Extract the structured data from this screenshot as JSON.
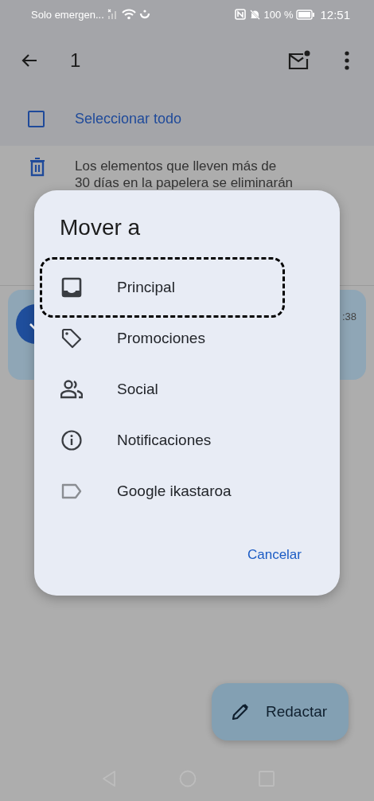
{
  "status_bar": {
    "carrier": "Solo emergen...",
    "battery": "100 %",
    "time": "12:51"
  },
  "toolbar": {
    "count": "1"
  },
  "select_all": {
    "label": "Seleccionar todo",
    "checked": false
  },
  "trash_notice": {
    "lines": [
      "Los elementos que lleven más de",
      "30 días en la papelera se eliminarán"
    ]
  },
  "email": {
    "selected": true,
    "time": ":38"
  },
  "dialog": {
    "title": "Mover a",
    "items": [
      {
        "label": "Principal",
        "kind": "inbox",
        "highlighted": true
      },
      {
        "label": "Promociones",
        "kind": "tag",
        "highlighted": false
      },
      {
        "label": "Social",
        "kind": "people",
        "highlighted": false
      },
      {
        "label": "Notificaciones",
        "kind": "info",
        "highlighted": false
      },
      {
        "label": "Google ikastaroa",
        "kind": "label",
        "highlighted": false
      }
    ],
    "cancel": "Cancelar"
  },
  "fab": {
    "label": "Redactar"
  }
}
